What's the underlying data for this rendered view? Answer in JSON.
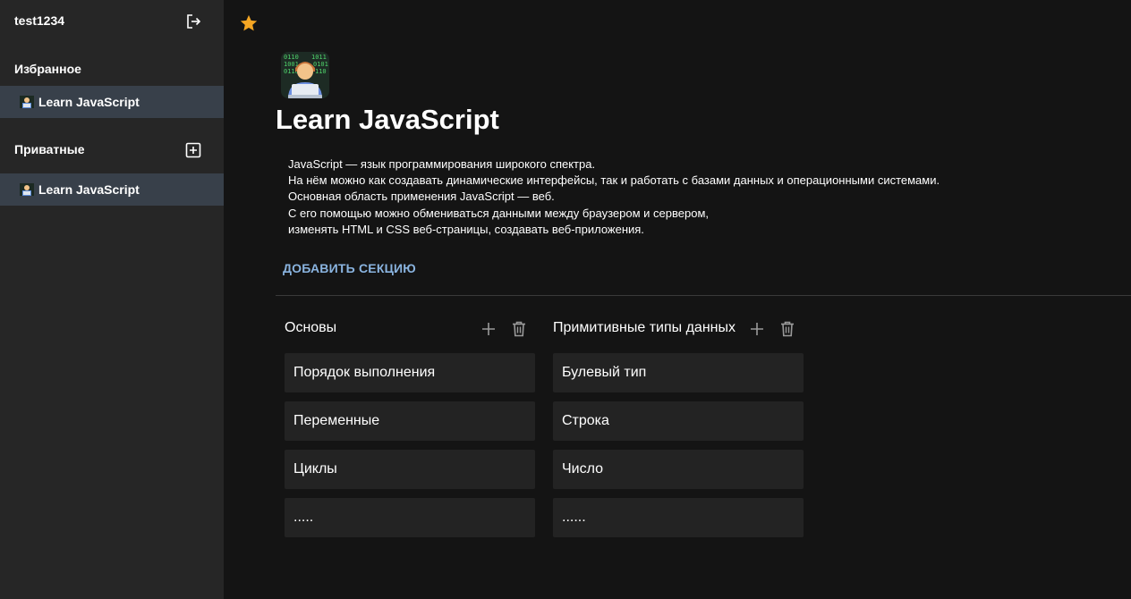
{
  "sidebar": {
    "user": "test1234",
    "favorites_label": "Избранное",
    "private_label": "Приватные",
    "favorites": [
      {
        "label": "Learn JavaScript"
      }
    ],
    "private": [
      {
        "label": "Learn JavaScript"
      }
    ]
  },
  "page": {
    "title": "Learn JavaScript",
    "description": [
      "JavaScript — язык программирования широкого спектра.",
      "На нём можно как создавать динамические интерфейсы, так и работать с базами данных и операционными системами.",
      "Основная область применения JavaScript — веб.",
      "С его помощью можно обмениваться данными между браузером и сервером,",
      "изменять HTML и CSS веб-страницы, создавать веб-приложения."
    ],
    "add_section_label": "ДОБАВИТЬ СЕКЦИЮ"
  },
  "columns": [
    {
      "title": "Основы",
      "cards": [
        "Порядок выполнения",
        "Переменные",
        "Циклы",
        "....."
      ]
    },
    {
      "title": "Примитивные типы данных",
      "cards": [
        "Булевый тип",
        "Строка",
        "Число",
        "......"
      ]
    }
  ],
  "colors": {
    "sidebar_bg": "#262626",
    "main_bg": "#141414",
    "active_item": "#38404a",
    "accent": "#8ab4e0",
    "star": "#f5a623"
  },
  "icons": {
    "logout": "logout-icon",
    "star": "star-icon",
    "add": "add-box-icon",
    "plus": "plus-icon",
    "trash": "trash-icon",
    "page": "technologist-emoji-icon"
  }
}
